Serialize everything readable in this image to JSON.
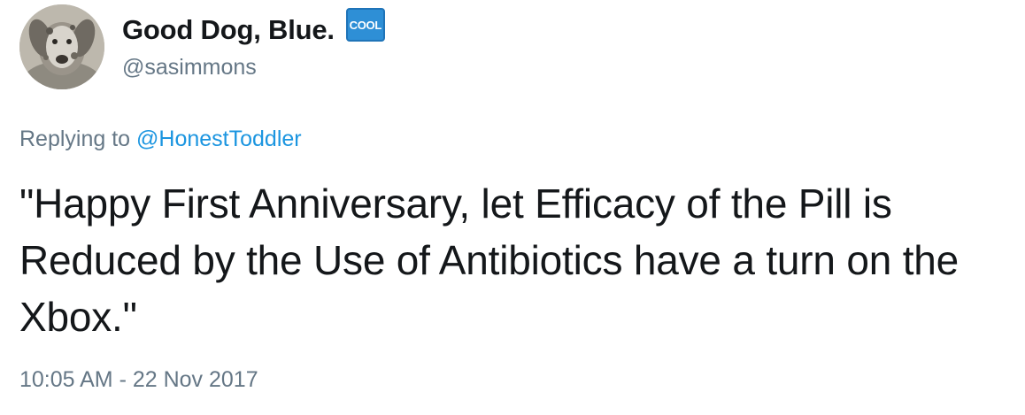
{
  "author": {
    "display_name": "Good Dog, Blue.",
    "badge_text": "COOL",
    "handle": "@sasimmons",
    "avatar_icon": "dog-avatar"
  },
  "reply": {
    "prefix": "Replying to",
    "mention": "@HonestToddler"
  },
  "tweet": {
    "text": "\"Happy First Anniversary, let Efficacy of the Pill is Reduced by the Use of Antibiotics have a turn on the Xbox.\"",
    "timestamp": "10:05 AM - 22 Nov 2017"
  },
  "colors": {
    "text": "#14171a",
    "secondary": "#657786",
    "link": "#1b95e0",
    "badge": "#2e8fd6"
  }
}
